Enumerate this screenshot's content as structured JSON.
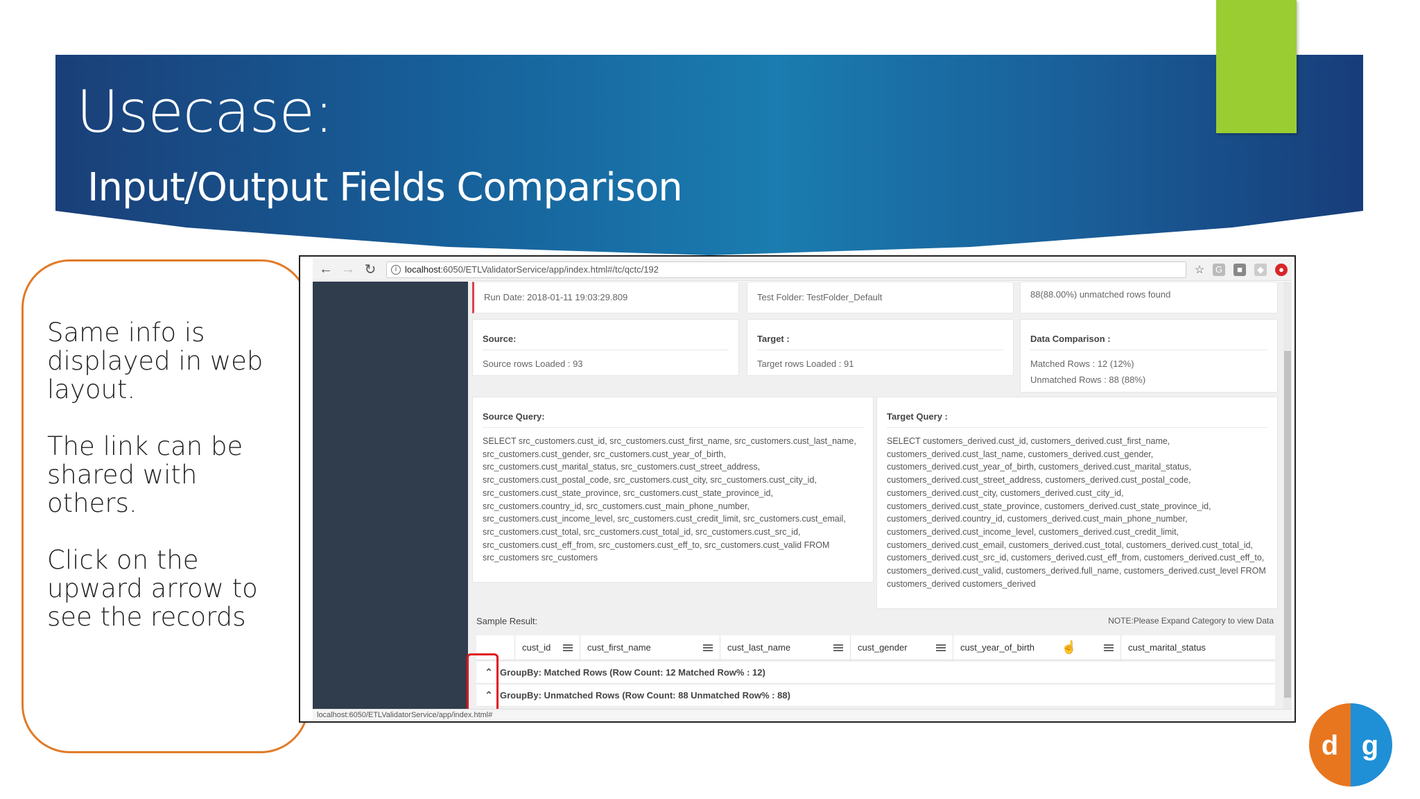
{
  "slide": {
    "title": "Usecase:",
    "subtitle": "Input/Output Fields Comparison",
    "accent_color": "#9acd32"
  },
  "notes": [
    "Same info is displayed in web layout.",
    "The link can be shared with others.",
    "Click on the upward arrow to see the records"
  ],
  "browser": {
    "url_host": "localhost",
    "url_path": ":6050/ETLValidatorService/app/index.html#/tc/qctc/192",
    "status_url": "localhost:6050/ETLValidatorService/app/index.html#"
  },
  "summary": {
    "run_date": "Run Date: 2018-01-11 19:03:29.809",
    "test_folder": "Test Folder: TestFolder_Default",
    "message": "88(88.00%) unmatched rows found",
    "source_header": "Source:",
    "source_rows": "Source rows Loaded : 93",
    "target_header": "Target :",
    "target_rows": "Target rows Loaded : 91",
    "comparison_header": "Data Comparison :",
    "matched_rows": "Matched Rows : 12 (12%)",
    "unmatched_rows": "Unmatched Rows : 88 (88%)"
  },
  "queries": {
    "source_header": "Source Query:",
    "source_sql": "SELECT src_customers.cust_id, src_customers.cust_first_name, src_customers.cust_last_name, src_customers.cust_gender, src_customers.cust_year_of_birth, src_customers.cust_marital_status, src_customers.cust_street_address, src_customers.cust_postal_code, src_customers.cust_city, src_customers.cust_city_id, src_customers.cust_state_province, src_customers.cust_state_province_id, src_customers.country_id, src_customers.cust_main_phone_number, src_customers.cust_income_level, src_customers.cust_credit_limit, src_customers.cust_email, src_customers.cust_total, src_customers.cust_total_id, src_customers.cust_src_id, src_customers.cust_eff_from, src_customers.cust_eff_to, src_customers.cust_valid  FROM src_customers src_customers",
    "target_header": "Target Query :",
    "target_sql": "SELECT customers_derived.cust_id, customers_derived.cust_first_name, customers_derived.cust_last_name, customers_derived.cust_gender, customers_derived.cust_year_of_birth, customers_derived.cust_marital_status, customers_derived.cust_street_address, customers_derived.cust_postal_code, customers_derived.cust_city, customers_derived.cust_city_id, customers_derived.cust_state_province, customers_derived.cust_state_province_id, customers_derived.country_id, customers_derived.cust_main_phone_number, customers_derived.cust_income_level, customers_derived.cust_credit_limit, customers_derived.cust_email, customers_derived.cust_total, customers_derived.cust_total_id, customers_derived.cust_src_id, customers_derived.cust_eff_from, customers_derived.cust_eff_to, customers_derived.cust_valid, customers_derived.full_name, customers_derived.cust_level  FROM customers_derived customers_derived"
  },
  "sample": {
    "label": "Sample Result:",
    "note": "NOTE:Please Expand Category to view Data",
    "columns": [
      "cust_id",
      "cust_first_name",
      "cust_last_name",
      "cust_gender",
      "cust_year_of_birth",
      "cust_marital_status"
    ],
    "groups": [
      "GroupBy: Matched Rows (Row Count: 12 Matched Row% : 12)",
      "GroupBy: Unmatched Rows (Row Count: 88 Unmatched Row% : 88)"
    ]
  },
  "logo": {
    "letters": "dg"
  }
}
